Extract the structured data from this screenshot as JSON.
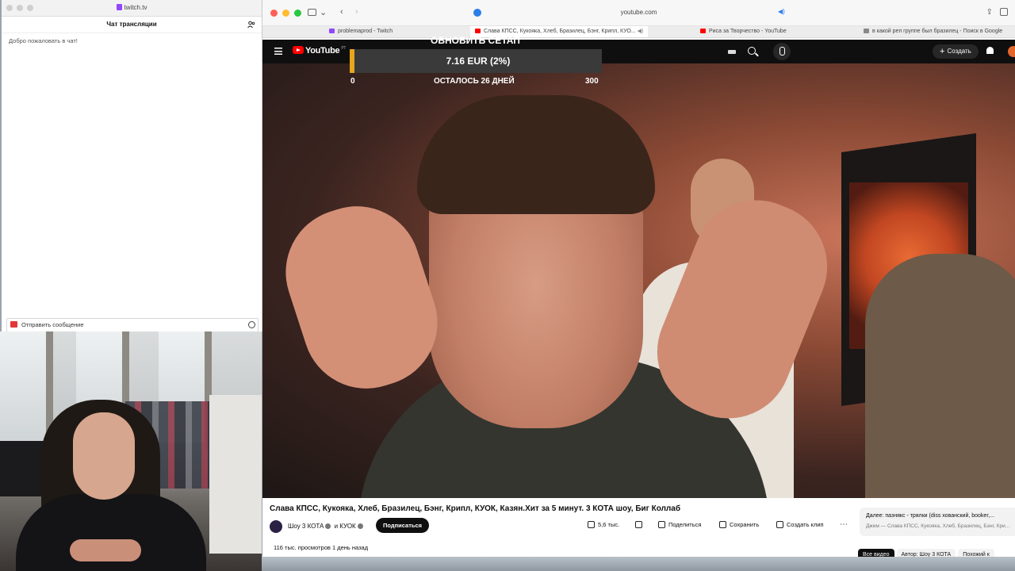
{
  "twitch": {
    "url": "twitch.tv",
    "chat_title": "Чат трансляции",
    "welcome": "Добро пожаловать в чат!",
    "input_placeholder": "Отправить сообщение"
  },
  "browser": {
    "url": "youtube.com",
    "tabs": [
      {
        "label": "problemaprod - Twitch",
        "color": "#9146ff"
      },
      {
        "label": "Слава КПСС, Кукояка, Хлеб, Бразилец, Бэнг, Крипл, КУО...",
        "color": "#ff0000"
      },
      {
        "label": "Риса за Творчество - YouTube",
        "color": "#ff0000"
      },
      {
        "label": "в какой реп группе был бразилец - Поиск в Google",
        "color": "#888888"
      }
    ]
  },
  "youtube": {
    "logo": "YouTube",
    "region": "PT",
    "create_label": "Создать",
    "overlay": {
      "goal_title": "ОБНОВИТЬ СЕТАП",
      "amount": "7.16 EUR (2%)",
      "min": "0",
      "days_left": "ОСТАЛОСЬ 26 ДНЕЙ",
      "max": "300",
      "progress": 0.02
    },
    "video_title": "Слава КПСС, Кукояка, Хлеб, Бразилец, Бэнг, Крипл, КУОК, Казян.Хит за 5 минут. 3 КОТА шоу, Биг Коллаб",
    "channel": "Шоу 3 КОТА",
    "channel_and": "и КУОК",
    "subscribe": "Подписаться",
    "likes": "5,6 тыс.",
    "share": "Поделиться",
    "save": "Сохранить",
    "clip": "Создать клип",
    "views": "116 тыс. просмотров  1 день назад",
    "next_title": "Далее: пазнякс - трялки (diss хованский, booker,...",
    "next_sub": "Джем — Слава КПСС, Кукояка, Хлеб, Бразилец, Бэнг, Кри...",
    "chips": [
      "Все видео",
      "Автор: Шоу 3 КОТА",
      "Похожий к"
    ]
  },
  "colors": {
    "youtube_red": "#ff0000",
    "twitch_purple": "#9146ff",
    "goal_accent": "#e8a51d"
  }
}
